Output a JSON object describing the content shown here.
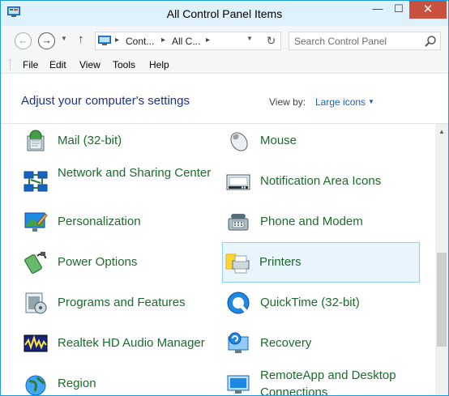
{
  "window": {
    "title": "All Control Panel Items",
    "minimize_glyph": "—",
    "maximize_glyph": "☐",
    "close_glyph": "✕"
  },
  "nav": {
    "back_glyph": "←",
    "forward_glyph": "→",
    "recent_glyph": "▼",
    "up_glyph": "↑",
    "refresh_glyph": "↻",
    "breadcrumb": [
      "Cont...",
      "All C..."
    ],
    "separator_glyph": "▸",
    "search_placeholder": "Search Control Panel"
  },
  "menu": {
    "items": [
      "File",
      "Edit",
      "View",
      "Tools",
      "Help"
    ]
  },
  "content": {
    "heading": "Adjust your computer's settings",
    "view_by_label": "View by:",
    "view_by_value": "Large icons",
    "caret": "▼"
  },
  "items": [
    {
      "label": "Mail (32-bit)",
      "icon": "mail-icon"
    },
    {
      "label": "Mouse",
      "icon": "mouse-icon"
    },
    {
      "label": "Network and Sharing Center",
      "icon": "network-icon"
    },
    {
      "label": "Notification Area Icons",
      "icon": "notification-area-icon"
    },
    {
      "label": "Personalization",
      "icon": "personalization-icon"
    },
    {
      "label": "Phone and Modem",
      "icon": "phone-icon"
    },
    {
      "label": "Power Options",
      "icon": "power-icon"
    },
    {
      "label": "Printers",
      "icon": "printer-icon",
      "selected": true
    },
    {
      "label": "Programs and Features",
      "icon": "programs-icon"
    },
    {
      "label": "QuickTime (32-bit)",
      "icon": "quicktime-icon"
    },
    {
      "label": "Realtek HD Audio Manager",
      "icon": "audio-icon"
    },
    {
      "label": "Recovery",
      "icon": "recovery-icon"
    },
    {
      "label": "Region",
      "icon": "region-icon"
    },
    {
      "label": "RemoteApp and Desktop Connections",
      "icon": "remoteapp-icon"
    }
  ],
  "colors": {
    "link_green": "#1c6b2c",
    "heading_blue": "#1e3287",
    "selection_fill": "#e8f5fc",
    "selection_border": "#8fd2f1",
    "close_red": "#c7503e"
  }
}
